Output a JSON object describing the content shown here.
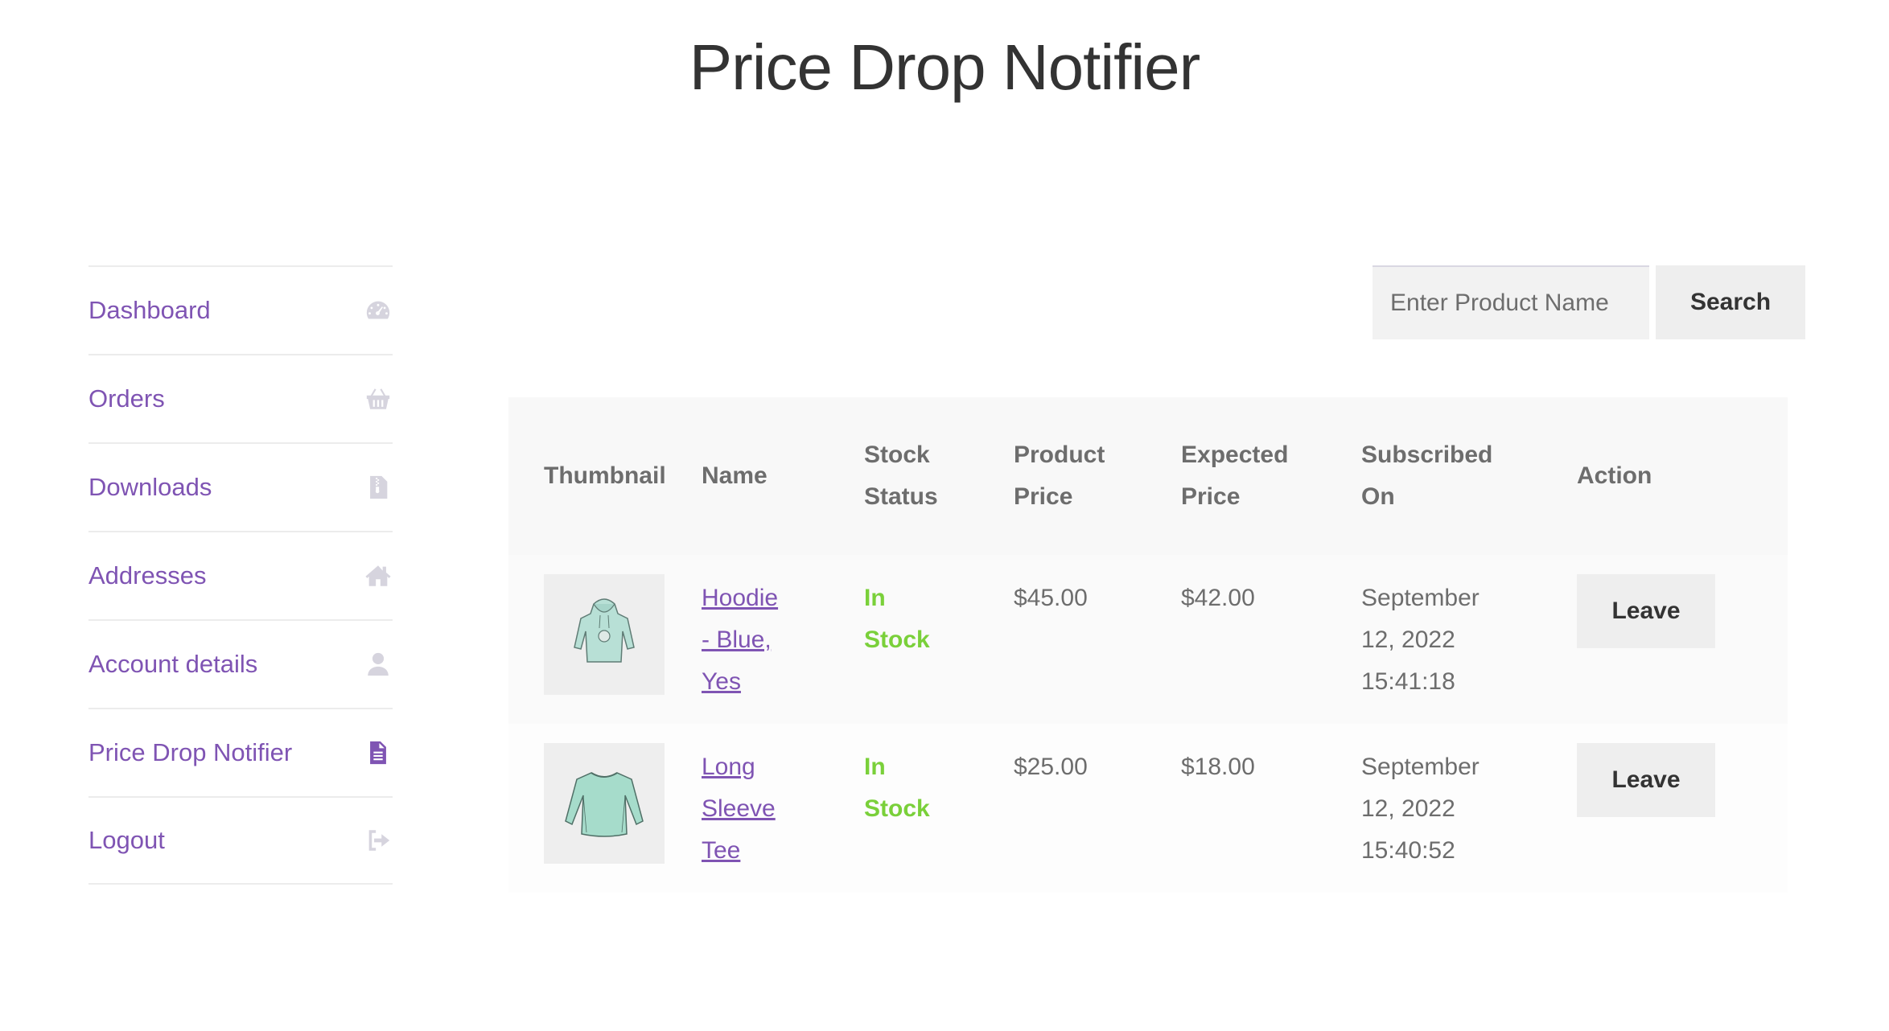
{
  "page": {
    "title": "Price Drop Notifier"
  },
  "nav": {
    "items": [
      {
        "label": "Dashboard",
        "icon": "dashboard-gauge-icon"
      },
      {
        "label": "Orders",
        "icon": "basket-icon"
      },
      {
        "label": "Downloads",
        "icon": "file-zip-icon"
      },
      {
        "label": "Addresses",
        "icon": "home-icon"
      },
      {
        "label": "Account details",
        "icon": "user-icon"
      },
      {
        "label": "Price Drop Notifier",
        "icon": "document-icon",
        "active": true
      },
      {
        "label": "Logout",
        "icon": "sign-out-icon"
      }
    ]
  },
  "search": {
    "placeholder": "Enter Product Name",
    "button_label": "Search"
  },
  "table": {
    "headers": {
      "thumbnail": "Thumbnail",
      "name": "Name",
      "stock_line1": "Stock",
      "stock_line2": "Status",
      "price_line1": "Product",
      "price_line2": "Price",
      "expected_line1": "Expected",
      "expected_line2": "Price",
      "subscribed_line1": "Subscribed",
      "subscribed_line2": "On",
      "action": "Action"
    },
    "rows": [
      {
        "name_lines": [
          "Hoodie",
          "- Blue,",
          "Yes"
        ],
        "stock_lines": [
          "In",
          "Stock"
        ],
        "product_price": "$45.00",
        "expected_price": "$42.00",
        "subscribed_lines": [
          "September",
          "12, 2022",
          "15:41:18"
        ],
        "action_label": "Leave"
      },
      {
        "name_lines": [
          "Long",
          "Sleeve",
          "Tee"
        ],
        "stock_lines": [
          "In",
          "Stock"
        ],
        "product_price": "$25.00",
        "expected_price": "$18.00",
        "subscribed_lines": [
          "September",
          "12, 2022",
          "15:40:52"
        ],
        "action_label": "Leave"
      }
    ]
  },
  "colors": {
    "accent": "#7f54b3",
    "in_stock": "#7ad03a",
    "icon_muted": "#d6d4de"
  }
}
